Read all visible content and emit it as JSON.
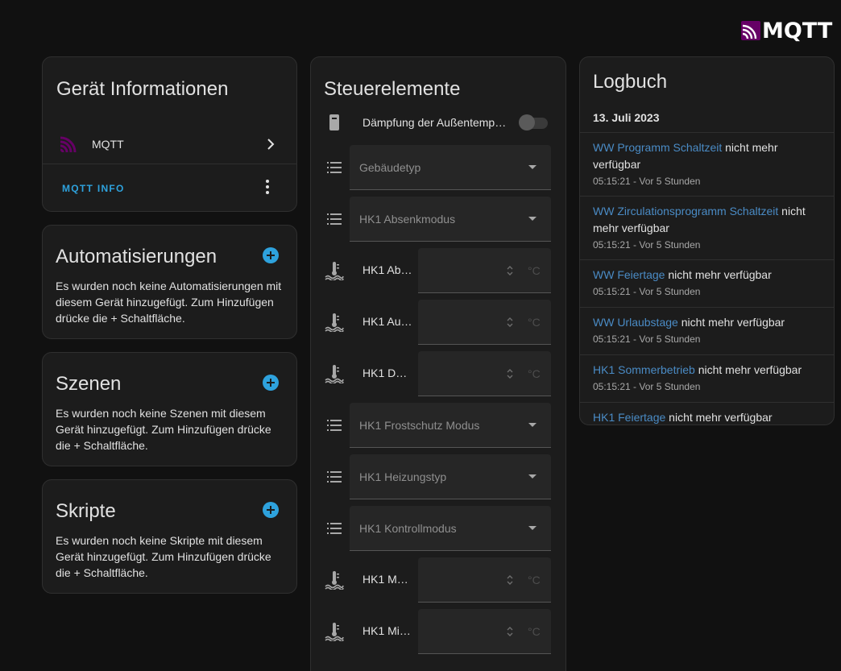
{
  "logo": {
    "text": "MQTT"
  },
  "device_info": {
    "title": "Gerät Informationen",
    "integration_label": "MQTT",
    "info_button": "MQTT INFO"
  },
  "automations": {
    "title": "Automatisierungen",
    "description": "Es wurden noch keine Automatisierungen mit diesem Gerät hinzugefügt. Zum Hinzufügen drücke die + Schaltfläche."
  },
  "scenes": {
    "title": "Szenen",
    "description": "Es wurden noch keine Szenen mit diesem Gerät hinzugefügt. Zum Hinzufügen drücke die + Schaltfläche."
  },
  "scripts": {
    "title": "Skripte",
    "description": "Es wurden noch keine Skripte mit diesem Gerät hinzugefügt. Zum Hinzufügen drücke die + Schaltfläche."
  },
  "controls": {
    "title": "Steuerelemente",
    "toggle": {
      "name": "Dämpfung der Außentempe…",
      "icon": "remote-icon"
    },
    "items": [
      {
        "type": "select",
        "label": "Gebäudetyp",
        "icon": "list-icon"
      },
      {
        "type": "select",
        "label": "HK1 Absenkmodus",
        "icon": "list-icon"
      },
      {
        "type": "number",
        "label": "HK1 Ab…",
        "unit": "°C",
        "icon": "water-thermometer-icon"
      },
      {
        "type": "number",
        "label": "HK1 Au…",
        "unit": "°C",
        "icon": "water-thermometer-icon"
      },
      {
        "type": "number",
        "label": "HK1 Dur…",
        "unit": "°C",
        "icon": "water-thermometer-icon"
      },
      {
        "type": "select",
        "label": "HK1 Frostschutz Modus",
        "icon": "list-icon"
      },
      {
        "type": "select",
        "label": "HK1 Heizungstyp",
        "icon": "list-icon"
      },
      {
        "type": "select",
        "label": "HK1 Kontrollmodus",
        "icon": "list-icon"
      },
      {
        "type": "number",
        "label": "HK1 Ma…",
        "unit": "°C",
        "icon": "water-thermometer-icon"
      },
      {
        "type": "number",
        "label": "HK1 Mi…",
        "unit": "°C",
        "icon": "water-thermometer-icon"
      }
    ]
  },
  "logbook": {
    "title": "Logbuch",
    "date": "13. Juli 2023",
    "entries": [
      {
        "entity": "WW Programm Schaltzeit",
        "message": "nicht mehr verfügbar",
        "time": "05:15:21 - Vor 5 Stunden"
      },
      {
        "entity": "WW Zirculationsprogramm Schaltzeit",
        "message": "nicht mehr verfügbar",
        "time": "05:15:21 - Vor 5 Stunden"
      },
      {
        "entity": "WW Feiertage",
        "message": "nicht mehr verfügbar",
        "time": "05:15:21 - Vor 5 Stunden"
      },
      {
        "entity": "WW Urlaubstage",
        "message": "nicht mehr verfügbar",
        "time": "05:15:21 - Vor 5 Stunden"
      },
      {
        "entity": "HK1 Sommerbetrieb",
        "message": "nicht mehr verfügbar",
        "time": "05:15:21 - Vor 5 Stunden"
      },
      {
        "entity": "HK1 Feiertage",
        "message": "nicht mehr verfügbar",
        "time": ""
      }
    ]
  },
  "colors": {
    "background": "#111111",
    "card": "#1c1c1c",
    "accent": "#2ea2dd",
    "link": "#4a8bc5",
    "mqtt_brand": "#660066"
  }
}
